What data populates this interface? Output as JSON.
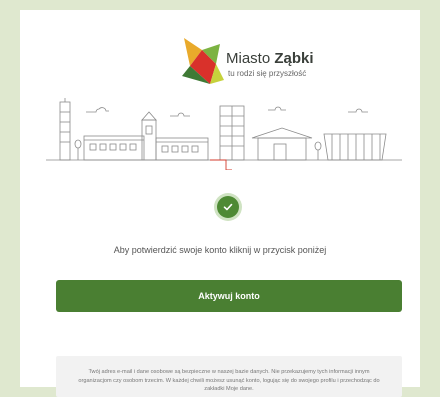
{
  "logo": {
    "name_regular": "Miasto ",
    "name_bold": "Ząbki",
    "tagline": "tu rodzi się przyszłość"
  },
  "icons": {
    "logo": "logo-mark-icon",
    "status": "checkmark-icon",
    "illustration": "city-skyline-illustration"
  },
  "colors": {
    "background": "#dfe8cf",
    "accent": "#4a7f32",
    "check_ring": "#cfe3c2"
  },
  "confirmation": {
    "instruction": "Aby potwierdzić swoje konto kliknij w przycisk poniżej",
    "button_label": "Aktywuj konto"
  },
  "privacy": {
    "text": "Twój adres e-mail i dane osobowe są bezpieczne w naszej bazie danych. Nie przekazujemy tych informacji innym organizacjom czy osobom trzecim. W każdej chwili możesz usunąć konto, logując się do swojego profilu i przechodząc do zakładki Moje dane."
  }
}
